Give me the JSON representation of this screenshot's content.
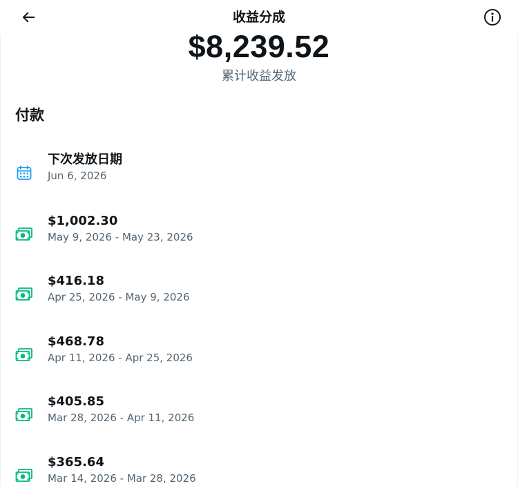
{
  "header": {
    "title": "收益分成",
    "back_icon": "arrow-left-icon",
    "info_icon": "info-icon"
  },
  "summary": {
    "amount": "$8,239.52",
    "label": "累计收益发放"
  },
  "payments": {
    "title": "付款",
    "next_payout": {
      "title": "下次发放日期",
      "date": "Jun 6, 2026",
      "icon": "calendar-icon"
    },
    "items": [
      {
        "amount": "$1,002.30",
        "period": "May 9, 2026 - May 23, 2026",
        "icon": "money-icon"
      },
      {
        "amount": "$416.18",
        "period": "Apr 25, 2026 - May 9, 2026",
        "icon": "money-icon"
      },
      {
        "amount": "$468.78",
        "period": "Apr 11, 2026 - Apr 25, 2026",
        "icon": "money-icon"
      },
      {
        "amount": "$405.85",
        "period": "Mar 28, 2026 - Apr 11, 2026",
        "icon": "money-icon"
      },
      {
        "amount": "$365.64",
        "period": "Mar 14, 2026 - Mar 28, 2026",
        "icon": "money-icon"
      }
    ]
  },
  "colors": {
    "text_primary": "#0f1419",
    "text_secondary": "#536471",
    "calendar_icon": "#1d9bf0",
    "money_icon": "#00ba7c"
  }
}
